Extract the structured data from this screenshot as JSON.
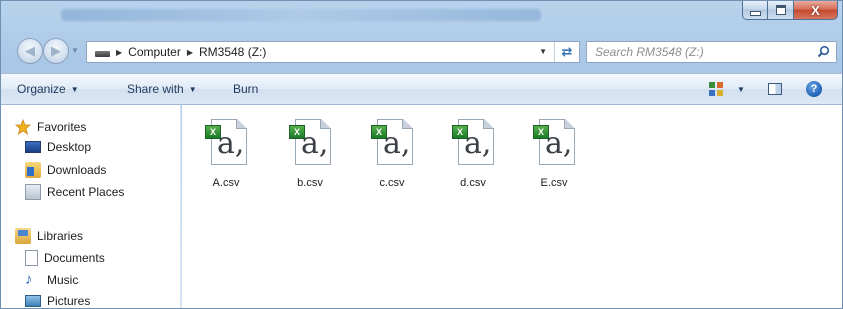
{
  "window": {
    "caption_buttons": {
      "minimize_icon": "minimize-icon",
      "maximize_icon": "maximize-icon",
      "close_glyph": "X"
    }
  },
  "navigation": {
    "breadcrumb": [
      "Computer",
      "RM3548 (Z:)"
    ],
    "refresh_icon": "refresh-icon",
    "search_placeholder": "Search RM3548 (Z:)"
  },
  "toolbar": {
    "organize_label": "Organize",
    "share_label": "Share with",
    "burn_label": "Burn"
  },
  "nav_pane": {
    "favorites": {
      "label": "Favorites",
      "items": [
        "Desktop",
        "Downloads",
        "Recent Places"
      ]
    },
    "libraries": {
      "label": "Libraries",
      "items": [
        "Documents",
        "Music",
        "Pictures"
      ]
    }
  },
  "files": [
    {
      "name": "A.csv",
      "icon": "excel-csv-icon"
    },
    {
      "name": "b.csv",
      "icon": "excel-csv-icon"
    },
    {
      "name": "c.csv",
      "icon": "excel-csv-icon"
    },
    {
      "name": "d.csv",
      "icon": "excel-csv-icon"
    },
    {
      "name": "E.csv",
      "icon": "excel-csv-icon"
    }
  ],
  "colors": {
    "command_text": "#1e395b",
    "excel_green": "#1d7a2b",
    "close_red": "#c44a2f",
    "accent_blue": "#2f6fb5"
  }
}
